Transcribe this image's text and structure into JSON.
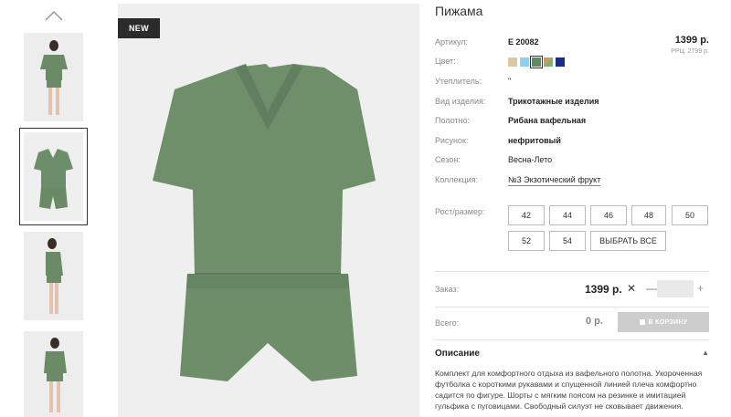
{
  "badge": "NEW",
  "product": {
    "title": "Пижама",
    "price": "1399 р.",
    "rrp": "РРЦ: 2799 р."
  },
  "attributes": [
    {
      "label": "Артикул:",
      "value": "Е 20082"
    },
    {
      "label": "Цвет:",
      "value": ""
    },
    {
      "label": "Утеплитель:",
      "value": "\""
    },
    {
      "label": "Вид изделия:",
      "value": "Трикотажные изделия"
    },
    {
      "label": "Полотно:",
      "value": "Рибана вафельная"
    },
    {
      "label": "Рисунок:",
      "value": "нефритовый"
    },
    {
      "label": "Сезон:",
      "value": "Весна-Лето"
    },
    {
      "label": "Коллекция:",
      "value": "№3 Экзотический фрукт"
    }
  ],
  "colors": [
    "#d9c7a6",
    "#8fd0f0",
    "#5f8a63",
    "#c9a05a",
    "#1a2a8a"
  ],
  "selected_color_index": 2,
  "sizes": {
    "label": "Рост/размер:",
    "options": [
      "42",
      "44",
      "46",
      "48",
      "50",
      "52",
      "54"
    ],
    "select_all": "ВЫБРАТЬ ВСЕ"
  },
  "order": {
    "label": "Заказ:",
    "price": "1399 р.",
    "multiply": "✕",
    "minus": "—",
    "quantity": "",
    "plus": "+"
  },
  "total": {
    "label": "Всего:",
    "value": "0 р.",
    "cart_button": "В КОРЗИНУ"
  },
  "description": {
    "title": "Описание",
    "caret": "▲",
    "text": "Комплект для комфортного отдыха из вафельного полотна. Укороченная футболка с короткими рукавами и спущенной линией плеча комфортно садится по фигуре. Шорты с мягким поясом на резинке и имитацией гульфика с пуговицами. Свободный силуэт не сковывает движения."
  },
  "icons": {
    "thumb_up": "chevron-up-icon",
    "cart": "shopping-bag-icon"
  }
}
